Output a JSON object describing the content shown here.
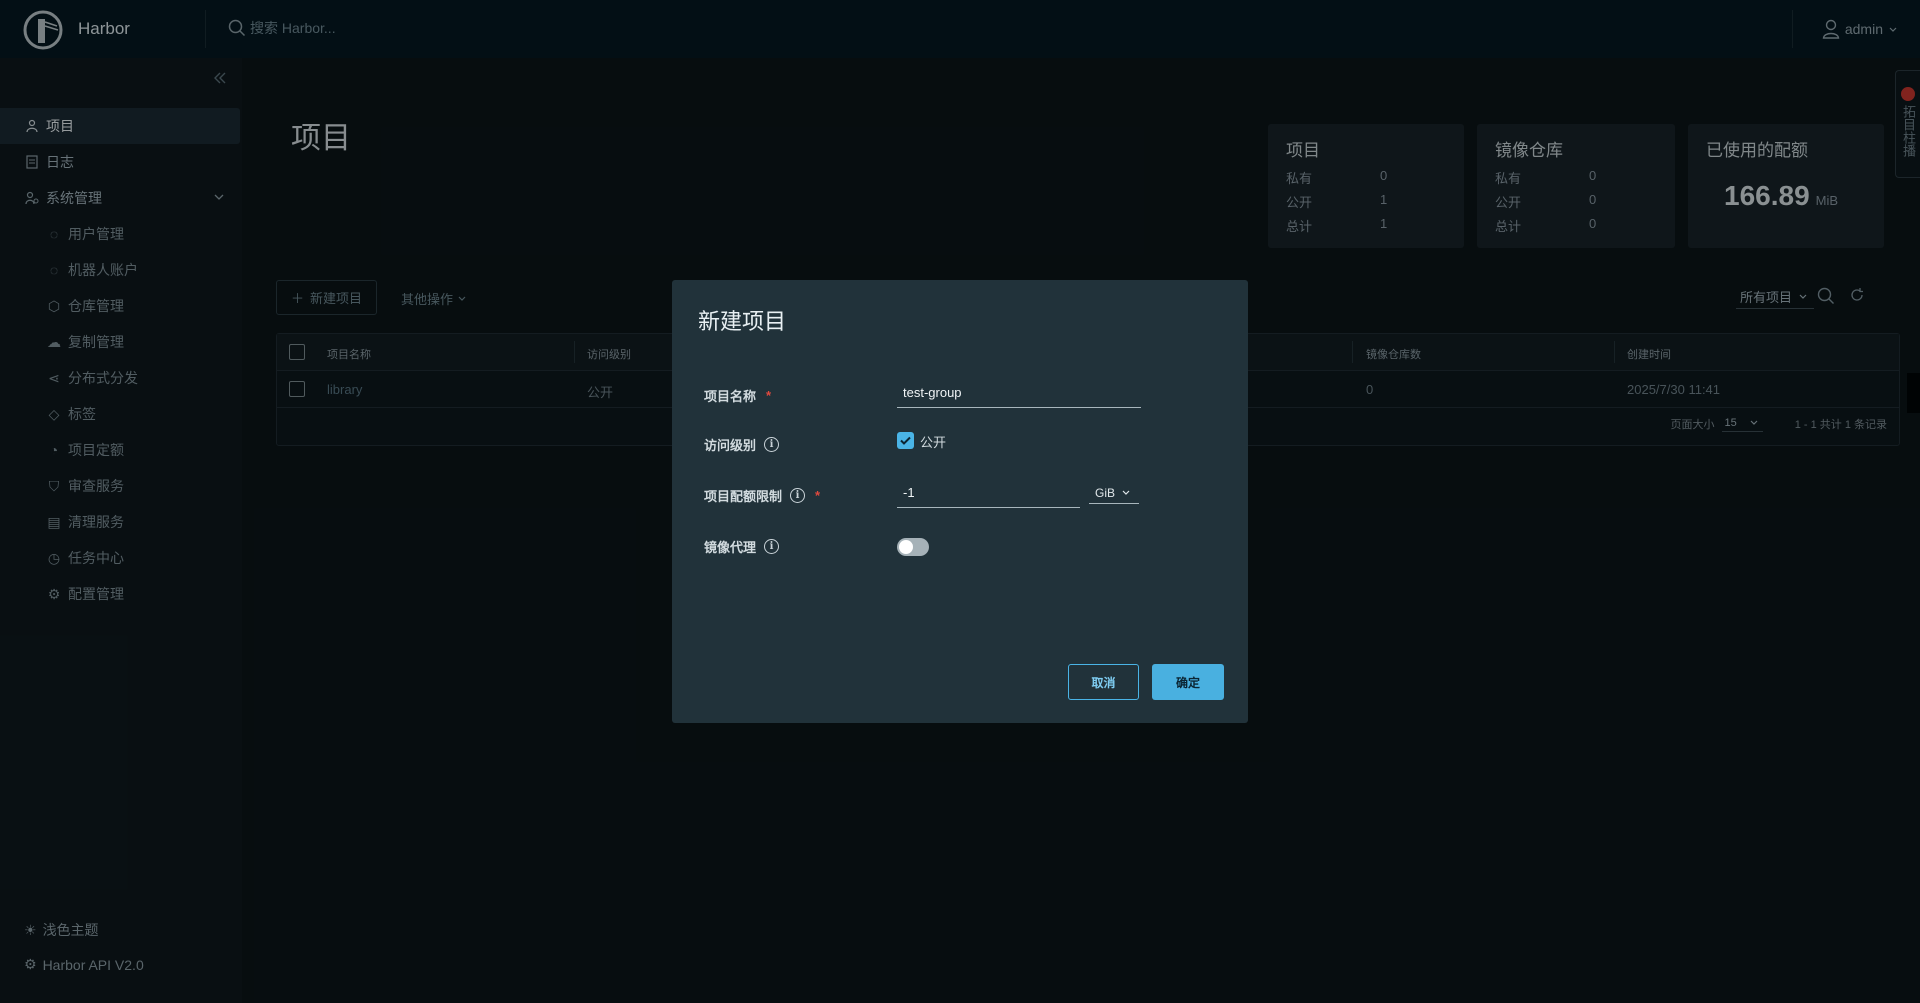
{
  "header": {
    "brand": "Harbor",
    "search_placeholder": "搜索 Harbor...",
    "user": "admin"
  },
  "sidebar": {
    "items": [
      {
        "label": "项目",
        "icon": "projects-icon"
      },
      {
        "label": "日志",
        "icon": "logs-icon"
      },
      {
        "label": "系统管理",
        "icon": "admin-icon"
      }
    ],
    "sub_items": [
      {
        "label": "用户管理",
        "icon": "users-icon"
      },
      {
        "label": "机器人账户",
        "icon": "robot-icon"
      },
      {
        "label": "仓库管理",
        "icon": "registry-icon"
      },
      {
        "label": "复制管理",
        "icon": "replication-icon"
      },
      {
        "label": "分布式分发",
        "icon": "distribution-icon"
      },
      {
        "label": "标签",
        "icon": "tag-icon"
      },
      {
        "label": "项目定额",
        "icon": "quota-icon"
      },
      {
        "label": "审查服务",
        "icon": "shield-icon"
      },
      {
        "label": "清理服务",
        "icon": "trash-icon"
      },
      {
        "label": "任务中心",
        "icon": "task-icon"
      },
      {
        "label": "配置管理",
        "icon": "settings-icon"
      }
    ],
    "theme": "浅色主题",
    "api": "Harbor API V2.0"
  },
  "main": {
    "title": "项目",
    "cards": {
      "projects": {
        "title": "项目",
        "rows": [
          {
            "k": "私有",
            "v": "0"
          },
          {
            "k": "公开",
            "v": "1"
          },
          {
            "k": "总计",
            "v": "1"
          }
        ]
      },
      "repos": {
        "title": "镜像仓库",
        "rows": [
          {
            "k": "私有",
            "v": "0"
          },
          {
            "k": "公开",
            "v": "0"
          },
          {
            "k": "总计",
            "v": "0"
          }
        ]
      },
      "quota": {
        "title": "已使用的配额",
        "value": "166.89",
        "unit": "MiB"
      }
    },
    "toolbar": {
      "new_project": "新建项目",
      "other_actions": "其他操作",
      "filter": "所有项目"
    },
    "table": {
      "headers": {
        "name": "项目名称",
        "access": "访问级别",
        "repo_count": "镜像仓库数",
        "created": "创建时间"
      },
      "rows": [
        {
          "name": "library",
          "access": "公开",
          "repo_count": "0",
          "created": "2025/7/30 11:41"
        }
      ],
      "footer": {
        "page_size_label": "页面大小",
        "page_size": "15",
        "summary": "1 - 1 共计 1 条记录"
      }
    },
    "side_tab": "拓目柱播"
  },
  "modal": {
    "title": "新建项目",
    "name_label": "项目名称",
    "name_value": "test-group",
    "access_label": "访问级别",
    "public_label": "公开",
    "public_checked": true,
    "quota_label": "项目配额限制",
    "quota_value": "-1",
    "quota_unit": "GiB",
    "proxy_label": "镜像代理",
    "proxy_enabled": false,
    "cancel": "取消",
    "ok": "确定"
  }
}
